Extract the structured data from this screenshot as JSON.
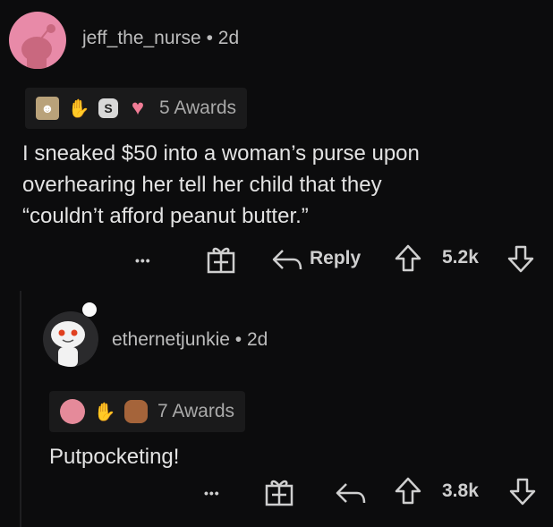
{
  "comment": {
    "username": "jeff_the_nurse",
    "age": "2d",
    "awards_label": "5 Awards",
    "body_lines": [
      "I sneaked $50 into a woman’s purse upon",
      "overhearing her tell her child that they",
      "“couldn’t afford peanut butter.”"
    ],
    "more_label": "•••",
    "reply_label": "Reply",
    "score": "5.2k",
    "avatar_color": "#e88aa8"
  },
  "reply": {
    "username": "ethernetjunkie",
    "age": "2d",
    "awards_label": "7 Awards",
    "body": "Putpocketing!",
    "more_label": "•••",
    "score": "3.8k"
  },
  "separator": "•"
}
